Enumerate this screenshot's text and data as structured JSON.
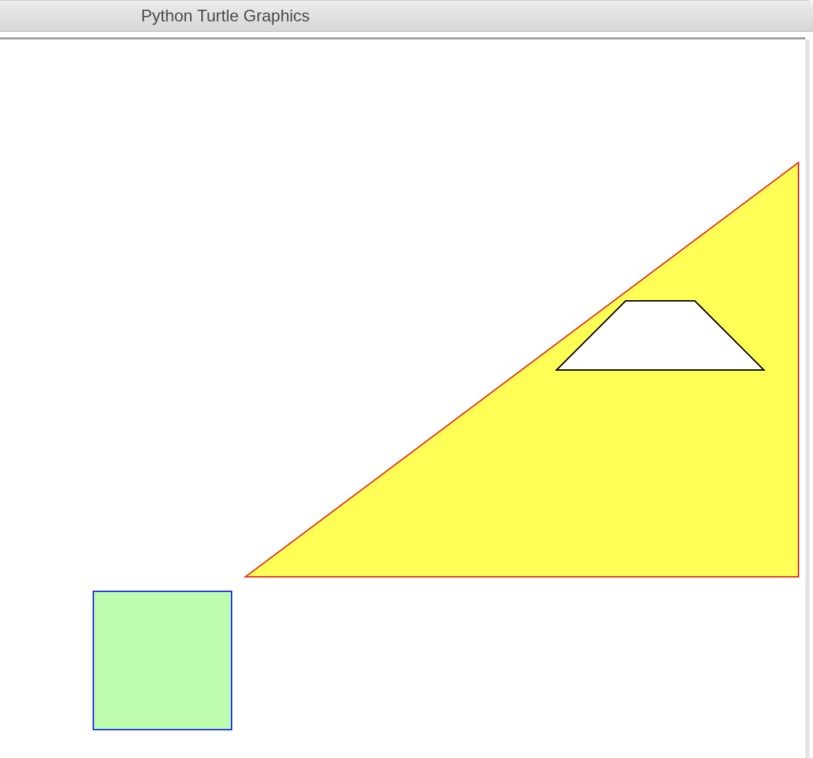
{
  "window": {
    "title": "Python Turtle Graphics"
  }
}
